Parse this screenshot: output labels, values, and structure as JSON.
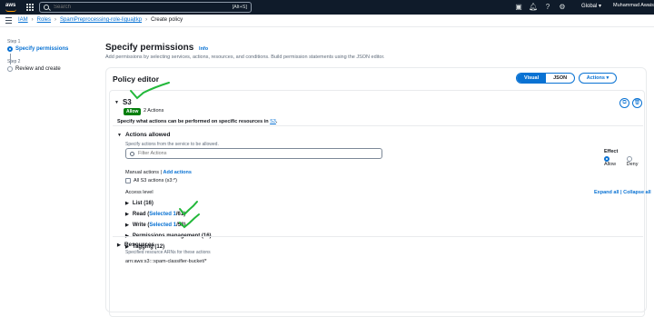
{
  "topbar": {
    "search_placeholder": "Search",
    "search_shortcut": "[Alt+S]",
    "region": "Global",
    "user": "Muhammad Awais"
  },
  "breadcrumb": {
    "items": [
      "IAM",
      "Roles",
      "SpamPreprocessing-role-liguajtkp"
    ],
    "current": "Create policy"
  },
  "steps": {
    "step1_label": "Step 1",
    "step1_title": "Specify permissions",
    "step2_label": "Step 2",
    "step2_title": "Review and create"
  },
  "page": {
    "title": "Specify permissions",
    "info": "Info",
    "subtitle": "Add permissions by selecting services, actions, resources, and conditions. Build permission statements using the JSON editor."
  },
  "editor": {
    "title": "Policy editor",
    "mode_visual": "Visual",
    "mode_json": "JSON",
    "actions_label": "Actions"
  },
  "service": {
    "name": "S3",
    "badge": "Allow",
    "count": "2 Actions",
    "spec_prefix": "Specify what actions can be performed on specific resources in",
    "spec_link": "S3",
    "spec_suffix": "."
  },
  "actions_allowed": {
    "heading": "Actions allowed",
    "description": "Specify actions from the service to be allowed.",
    "filter_placeholder": "Filter Actions",
    "effect_label": "Effect",
    "effect_allow": "Allow",
    "effect_deny": "Deny",
    "manual_label": "Manual actions |",
    "add_actions": "Add actions",
    "all_s3": "All S3 actions (s3:*)",
    "access_level": "Access level",
    "expand_collapse": "Expand all | Collapse all",
    "levels": [
      {
        "label": "List (16)"
      },
      {
        "label": "Read (",
        "selected": "Selected 1",
        "rest": "/61)"
      },
      {
        "label": "Write (",
        "selected": "Selected 1",
        "rest": "/58)"
      },
      {
        "label": "Permissions management (16)"
      },
      {
        "label": "Tagging (12)"
      }
    ]
  },
  "resources": {
    "heading": "Resources",
    "description": "Specified resource ARNs for these actions",
    "arn": "arn:aws:s3:::spam-classifier-bucket/*"
  },
  "colors": {
    "accent": "#0972d3",
    "allow": "#037f0c",
    "annotation": "#22b83a",
    "topbar": "#0f1b2a"
  }
}
